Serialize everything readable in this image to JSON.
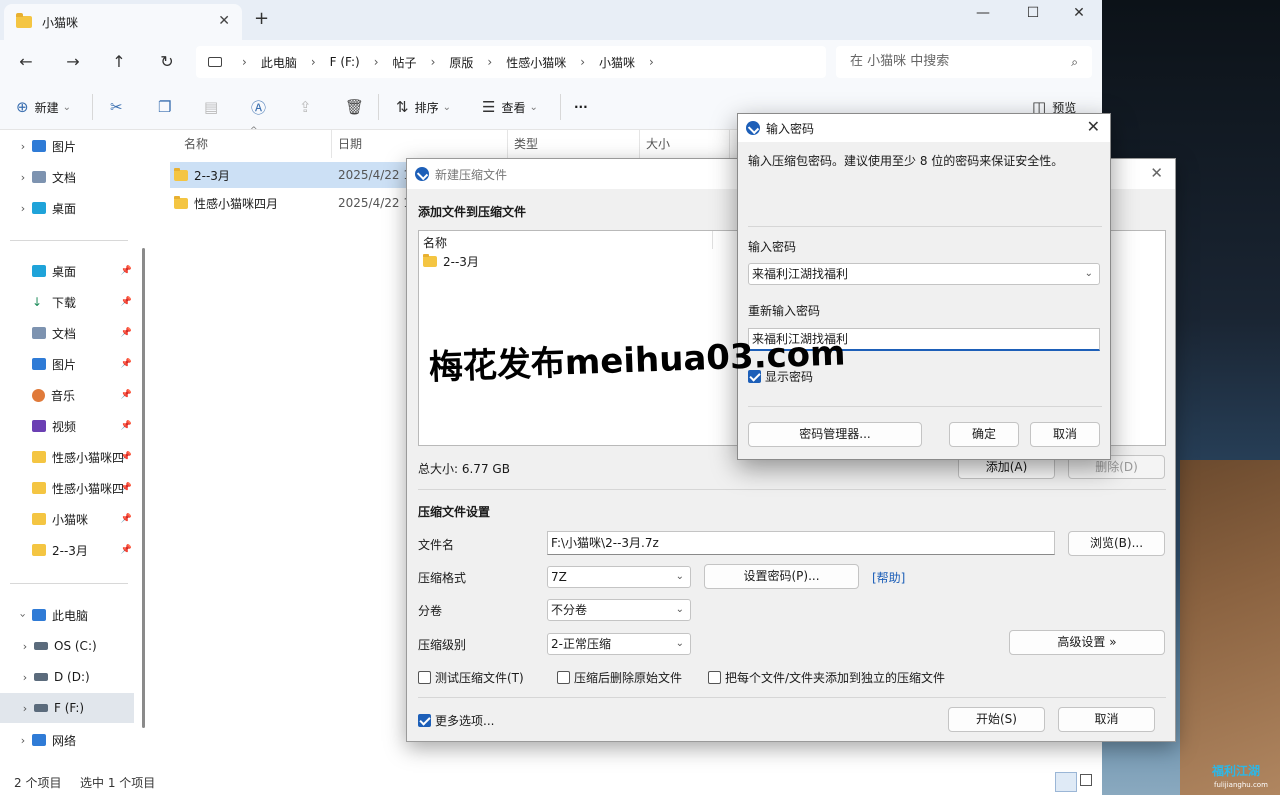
{
  "window": {
    "tab_title": "小猫咪",
    "new_tab": "+",
    "minimize": "—",
    "maximize": "☐",
    "close": "✕"
  },
  "address": {
    "segments": [
      "此电脑",
      "F (F:)",
      "帖子",
      "原版",
      "性感小猫咪",
      "小猫咪"
    ],
    "separator": "›",
    "search_placeholder": "在 小猫咪 中搜索"
  },
  "toolbar": {
    "new_label": "新建",
    "sort_label": "排序",
    "view_label": "查看",
    "more_label": "···",
    "preview_label": "预览",
    "dropdown": "⌄"
  },
  "sidebar": {
    "top_items": [
      {
        "label": "图片",
        "icon": "pictures-icon"
      },
      {
        "label": "文档",
        "icon": "documents-icon"
      },
      {
        "label": "桌面",
        "icon": "desktop-icon"
      }
    ],
    "quick_access": [
      {
        "label": "桌面",
        "icon": "desktop-icon"
      },
      {
        "label": "下载",
        "icon": "download-icon"
      },
      {
        "label": "文档",
        "icon": "documents-icon"
      },
      {
        "label": "图片",
        "icon": "pictures-icon"
      },
      {
        "label": "音乐",
        "icon": "music-icon"
      },
      {
        "label": "视频",
        "icon": "video-icon"
      },
      {
        "label": "性感小猫咪四",
        "icon": "folder-icon"
      },
      {
        "label": "性感小猫咪四",
        "icon": "folder-icon"
      },
      {
        "label": "小猫咪",
        "icon": "folder-icon"
      },
      {
        "label": "2--3月",
        "icon": "folder-icon"
      }
    ],
    "this_pc": "此电脑",
    "drives": [
      "OS (C:)",
      "D (D:)",
      "F (F:)"
    ],
    "network": "网络"
  },
  "filelist": {
    "columns": [
      "名称",
      "日期",
      "类型",
      "大小"
    ],
    "rows": [
      {
        "name": "2--3月",
        "date": "2025/4/22 1"
      },
      {
        "name": "性感小猫咪四月",
        "date": "2025/4/22 1"
      }
    ]
  },
  "statusbar": {
    "count": "2 个项目",
    "selected": "选中 1 个项目"
  },
  "zip_dialog": {
    "title": "新建压缩文件",
    "add_section": "添加文件到压缩文件",
    "list_header": "名称",
    "list_item": "2--3月",
    "total_size": "总大小: 6.77 GB",
    "add_button": "添加(A)",
    "delete_button": "删除(D)",
    "settings_section": "压缩文件设置",
    "filename_label": "文件名",
    "filename_value": "F:\\小猫咪\\2--3月.7z",
    "browse_button": "浏览(B)...",
    "format_label": "压缩格式",
    "format_value": "7Z",
    "set_password_button": "设置密码(P)...",
    "help_link": "[帮助]",
    "split_label": "分卷",
    "split_value": "不分卷",
    "level_label": "压缩级别",
    "level_value": "2-正常压缩",
    "advanced_button": "高级设置 »",
    "test_check": "测试压缩文件(T)",
    "delete_after_check": "压缩后删除原始文件",
    "separate_check": "把每个文件/文件夹添加到独立的压缩文件",
    "more_options": "更多选项...",
    "start_button": "开始(S)",
    "cancel_button": "取消"
  },
  "password_dialog": {
    "title": "输入密码",
    "description": "输入压缩包密码。建议使用至少 8 位的密码来保证安全性。",
    "enter_label": "输入密码",
    "enter_value": "来福利江湖找福利",
    "reenter_label": "重新输入密码",
    "reenter_value": "来福利江湖找福利",
    "show_password": "显示密码",
    "manager_button": "密码管理器...",
    "ok_button": "确定",
    "cancel_button": "取消"
  },
  "watermark": "梅花发布meihua03.com",
  "desktop_logo": "福利江湖",
  "desktop_logo_sub": "fulijianghu.com"
}
